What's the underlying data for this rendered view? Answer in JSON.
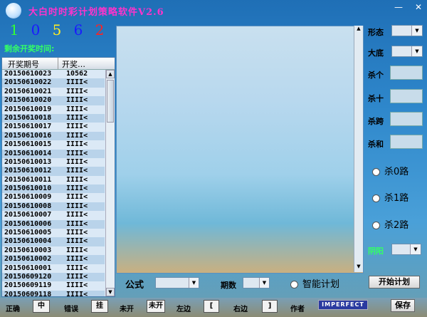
{
  "window": {
    "title": "大白时时彩计划策略软件V2.6",
    "minimize_glyph": "—",
    "close_glyph": "✕"
  },
  "latest_draw": {
    "digits": [
      {
        "value": "1",
        "color": "#33ff33"
      },
      {
        "value": "0",
        "color": "#1a1aff"
      },
      {
        "value": "5",
        "color": "#ffee22"
      },
      {
        "value": "6",
        "color": "#1a1aff"
      },
      {
        "value": "2",
        "color": "#ff2222"
      }
    ],
    "countdown_label": "剩余开奖时间:"
  },
  "draw_list": {
    "headers": [
      "开奖期号",
      "开奖…"
    ],
    "rows": [
      {
        "period": "20150610023",
        "value": "10562"
      },
      {
        "period": "20150610022",
        "value": "IIII<"
      },
      {
        "period": "20150610021",
        "value": "IIII<"
      },
      {
        "period": "20150610020",
        "value": "IIII<"
      },
      {
        "period": "20150610019",
        "value": "IIII<"
      },
      {
        "period": "20150610018",
        "value": "IIII<"
      },
      {
        "period": "20150610017",
        "value": "IIII<"
      },
      {
        "period": "20150610016",
        "value": "IIII<"
      },
      {
        "period": "20150610015",
        "value": "IIII<"
      },
      {
        "period": "20150610014",
        "value": "IIII<"
      },
      {
        "period": "20150610013",
        "value": "IIII<"
      },
      {
        "period": "20150610012",
        "value": "IIII<"
      },
      {
        "period": "20150610011",
        "value": "IIII<"
      },
      {
        "period": "20150610010",
        "value": "IIII<"
      },
      {
        "period": "20150610009",
        "value": "IIII<"
      },
      {
        "period": "20150610008",
        "value": "IIII<"
      },
      {
        "period": "20150610007",
        "value": "IIII<"
      },
      {
        "period": "20150610006",
        "value": "IIII<"
      },
      {
        "period": "20150610005",
        "value": "IIII<"
      },
      {
        "period": "20150610004",
        "value": "IIII<"
      },
      {
        "period": "20150610003",
        "value": "IIII<"
      },
      {
        "period": "20150610002",
        "value": "IIII<"
      },
      {
        "period": "20150610001",
        "value": "IIII<"
      },
      {
        "period": "20150609120",
        "value": "IIII<"
      },
      {
        "period": "20150609119",
        "value": "IIII<"
      },
      {
        "period": "20150609118",
        "value": "IIII<"
      }
    ]
  },
  "right_panel": {
    "xingtai_label": "形态",
    "dadi_label": "大底",
    "shage_label": "杀个",
    "shashi_label": "杀十",
    "shakua_label": "杀跨",
    "shahe_label": "杀和",
    "radios": [
      "杀0路",
      "杀1路",
      "杀2路"
    ],
    "yinyang_label": "阴阳"
  },
  "bottom_bar": {
    "formula_label": "公式",
    "periods_label": "期数",
    "smart_plan_label": "智能计划",
    "start_plan_label": "开始计划"
  },
  "status_bar": {
    "correct_label": "正确",
    "hit_button": "中",
    "wrong_label": "错误",
    "hang_button": "挂",
    "not_open_label": "未开",
    "not_open_button": "未开",
    "left_label": "左边",
    "left_button": "[",
    "right_label": "右边",
    "right_button": "]",
    "author_label": "作者",
    "logo_text": "IMPERFECT",
    "save_button": "保存"
  }
}
